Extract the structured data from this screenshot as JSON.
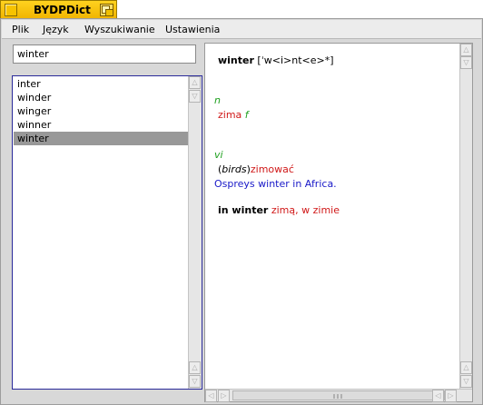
{
  "app": {
    "title": "BYDPDict"
  },
  "menu": [
    "Plik",
    "Język",
    "Wyszukiwanie",
    "Ustawienia"
  ],
  "search": {
    "value": "winter"
  },
  "word_list": {
    "items": [
      "inter",
      "winder",
      "winger",
      "winner",
      "winter"
    ],
    "selected_index": 4
  },
  "entry": {
    "headword": "winter",
    "pronunciation": "[ˈw<i>nt<e>*]",
    "senses": [
      {
        "pos": "n",
        "translation": "zima",
        "gender": "f"
      },
      {
        "pos": "vi",
        "context_open": "(",
        "context": "birds",
        "context_close": ")",
        "translation": "zimować",
        "example": "Ospreys winter in Africa."
      }
    ],
    "phrase": {
      "text": "in winter",
      "translation": "zimą, w zimie"
    }
  },
  "icons": {
    "scroll_up": "scroll-up-arrow-icon",
    "scroll_down": "scroll-down-arrow-icon",
    "scroll_left": "scroll-left-arrow-icon",
    "scroll_right": "scroll-right-arrow-icon",
    "zoom": "window-zoom-icon"
  },
  "colors": {
    "title_bar": "#f5c400",
    "selection": "#989898",
    "list_border": "#2a2a9a",
    "part_of_speech": "#1fa01f",
    "translation": "#d01818",
    "example": "#1818c8"
  }
}
